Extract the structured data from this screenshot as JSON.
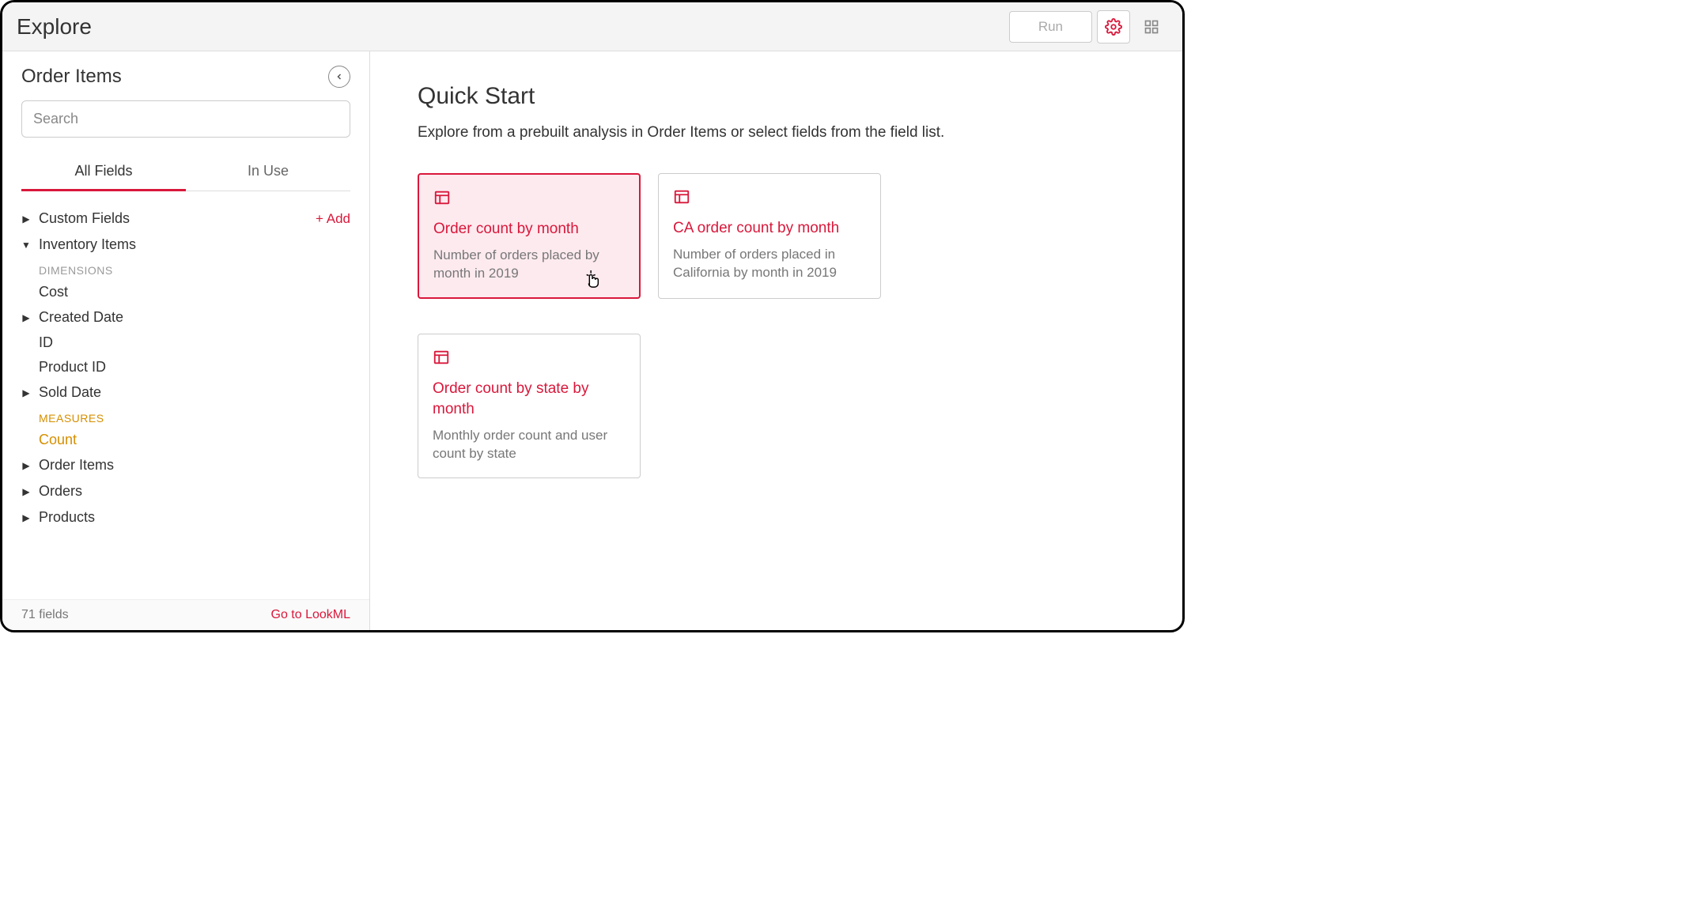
{
  "header": {
    "title": "Explore",
    "run_label": "Run"
  },
  "sidebar": {
    "title": "Order Items",
    "search_placeholder": "Search",
    "tabs": {
      "all": "All Fields",
      "inuse": "In Use"
    },
    "add_label": "+  Add",
    "groups": {
      "custom": "Custom Fields",
      "inventory": "Inventory Items",
      "orderitems": "Order Items",
      "orders": "Orders",
      "products": "Products"
    },
    "dimensions_label": "DIMENSIONS",
    "measures_label": "MEASURES",
    "fields": {
      "cost": "Cost",
      "created": "Created Date",
      "id": "ID",
      "productid": "Product ID",
      "sold": "Sold Date",
      "count": "Count"
    },
    "footer_count": "71 fields",
    "footer_link": "Go to LookML"
  },
  "main": {
    "title": "Quick Start",
    "subtitle": "Explore from a prebuilt analysis in Order Items or select fields from the field list."
  },
  "cards": [
    {
      "title": "Order count by month",
      "desc": "Number of orders placed by month in 2019"
    },
    {
      "title": "CA order count by month",
      "desc": "Number of orders placed in California by month in 2019"
    },
    {
      "title": "Order count by state by month",
      "desc": "Monthly order count and user count by state"
    }
  ]
}
